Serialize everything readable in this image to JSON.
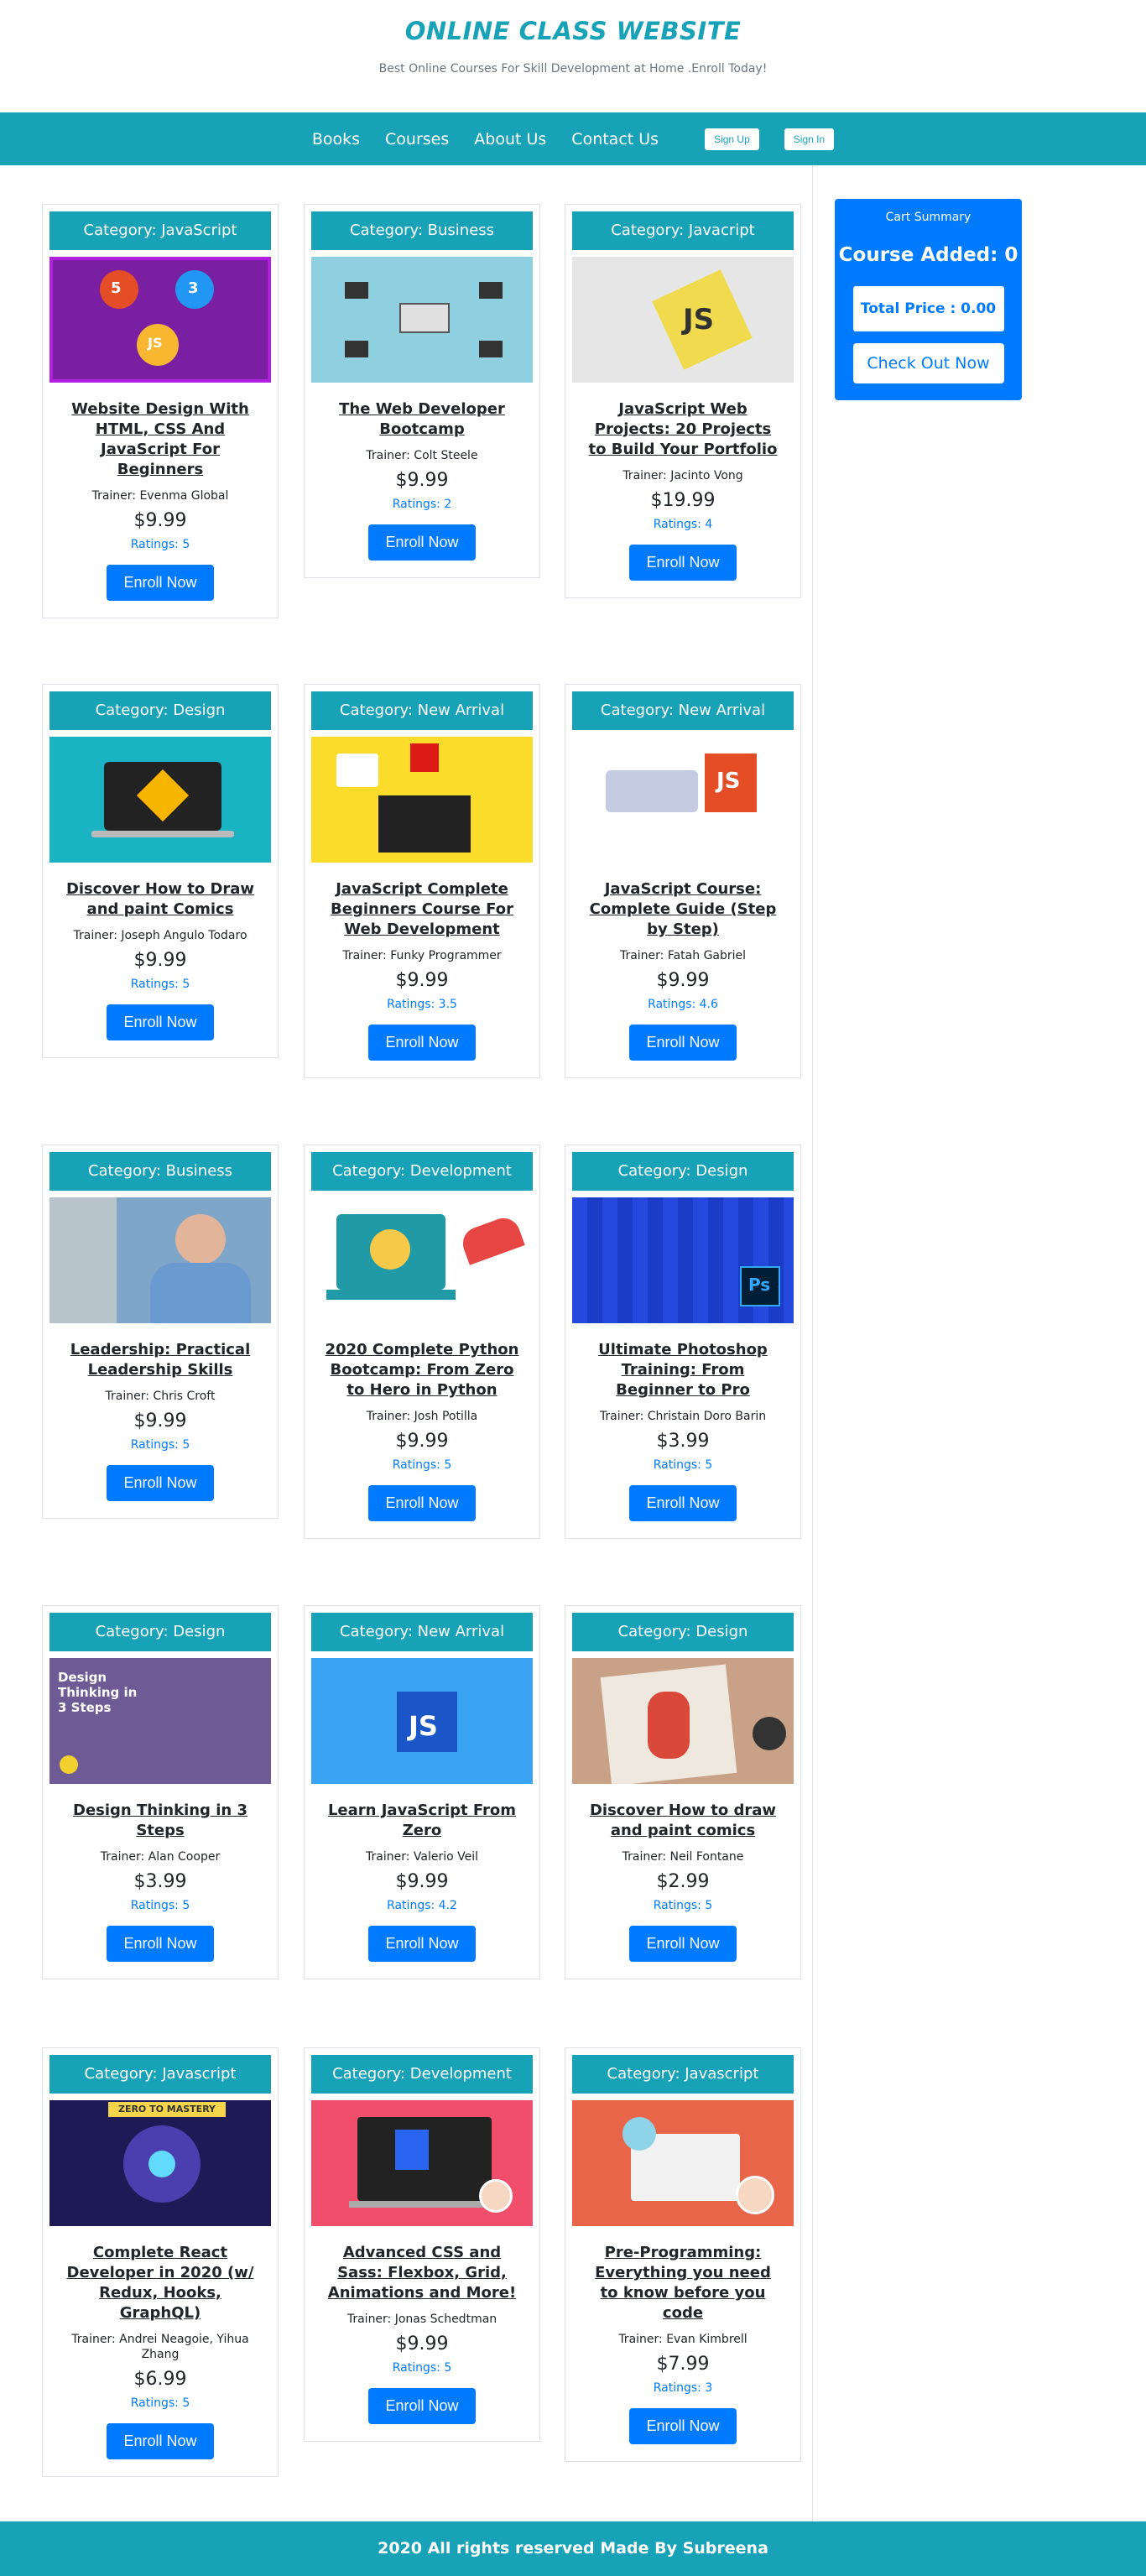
{
  "header": {
    "title": "ONLINE CLASS WEBSITE",
    "tagline": "Best Online Courses For Skill Development at Home .Enroll Today!"
  },
  "nav": {
    "links": [
      "Books",
      "Courses",
      "About Us",
      "Contact Us"
    ],
    "sign_up": "Sign Up",
    "sign_in": "Sign In"
  },
  "cart": {
    "title": "Cart Summary",
    "added": "Course Added: 0",
    "total": "Total Price : 0.00",
    "checkout": "Check Out Now"
  },
  "enroll_label": "Enroll Now",
  "courses": [
    {
      "category": "Category: JavaScript",
      "title": "Website Design With HTML, CSS And JavaScript For Beginners",
      "trainer": "Trainer: Evenma Global",
      "price": "$9.99",
      "rating": "Ratings: 5",
      "thumb": "purple"
    },
    {
      "category": "Category: Business",
      "title": "The Web Developer Bootcamp",
      "trainer": "Trainer: Colt Steele",
      "price": "$9.99",
      "rating": "Ratings: 2",
      "thumb": "lightblue"
    },
    {
      "category": "Category: Javacript",
      "title": "JavaScript Web Projects: 20 Projects to Build Your Portfolio",
      "trainer": "Trainer: Jacinto Vong",
      "price": "$19.99",
      "rating": "Ratings: 4",
      "thumb": "jsgray"
    },
    {
      "category": "Category: Design",
      "title": "Discover How to Draw and paint Comics",
      "trainer": "Trainer: Joseph Angulo Todaro",
      "price": "$9.99",
      "rating": "Ratings: 5",
      "thumb": "teal"
    },
    {
      "category": "Category: New Arrival",
      "title": "JavaScript Complete Beginners Course For Web Development",
      "trainer": "Trainer: Funky Programmer",
      "price": "$9.99",
      "rating": "Ratings: 3.5",
      "thumb": "yellow"
    },
    {
      "category": "Category: New Arrival",
      "title": "JavaScript Course: Complete Guide (Step by Step)",
      "trainer": "Trainer: Fatah Gabriel",
      "price": "$9.99",
      "rating": "Ratings: 4.6",
      "thumb": "white"
    },
    {
      "category": "Category: Business",
      "title": "Leadership: Practical Leadership Skills",
      "trainer": "Trainer: Chris Croft",
      "price": "$9.99",
      "rating": "Ratings: 5",
      "thumb": "photo"
    },
    {
      "category": "Category: Development",
      "title": "2020 Complete Python Bootcamp: From Zero to Hero in Python",
      "trainer": "Trainer: Josh Potilla",
      "price": "$9.99",
      "rating": "Ratings: 5",
      "thumb": "python"
    },
    {
      "category": "Category: Design",
      "title": "Ultimate Photoshop Training: From Beginner to Pro",
      "trainer": "Trainer: Christain Doro Barin",
      "price": "$3.99",
      "rating": "Ratings: 5",
      "thumb": "ps"
    },
    {
      "category": "Category: Design",
      "title": "Design Thinking in 3 Steps",
      "trainer": "Trainer: Alan Cooper",
      "price": "$3.99",
      "rating": "Ratings: 5",
      "thumb": "dthink"
    },
    {
      "category": "Category: New Arrival",
      "title": "Learn JavaScript From Zero",
      "trainer": "Trainer: Valerio Veil",
      "price": "$9.99",
      "rating": "Ratings: 4.2",
      "thumb": "jsblue"
    },
    {
      "category": "Category: Design",
      "title": "Discover How to draw and paint comics",
      "trainer": "Trainer: Neil Fontane",
      "price": "$2.99",
      "rating": "Ratings: 5",
      "thumb": "sketch"
    },
    {
      "category": "Category: Javascript",
      "title": "Complete React Developer in 2020 (w/ Redux, Hooks, GraphQL)",
      "trainer": "Trainer: Andrei Neagoie, Yihua Zhang",
      "price": "$6.99",
      "rating": "Ratings: 5",
      "thumb": "react"
    },
    {
      "category": "Category: Development",
      "title": "Advanced CSS and Sass: Flexbox, Grid, Animations and More!",
      "trainer": "Trainer: Jonas Schedtman",
      "price": "$9.99",
      "rating": "Ratings: 5",
      "thumb": "css"
    },
    {
      "category": "Category: Javascript",
      "title": "Pre-Programming: Everything you need to know before you code",
      "trainer": "Trainer: Evan Kimbrell",
      "price": "$7.99",
      "rating": "Ratings: 3",
      "thumb": "preprog"
    }
  ],
  "thumb_texts": {
    "dthink": "Design Thinking in 3 Steps",
    "react": "ZERO TO MASTERY"
  },
  "footer": "2020 All rights reserved Made By Subreena"
}
